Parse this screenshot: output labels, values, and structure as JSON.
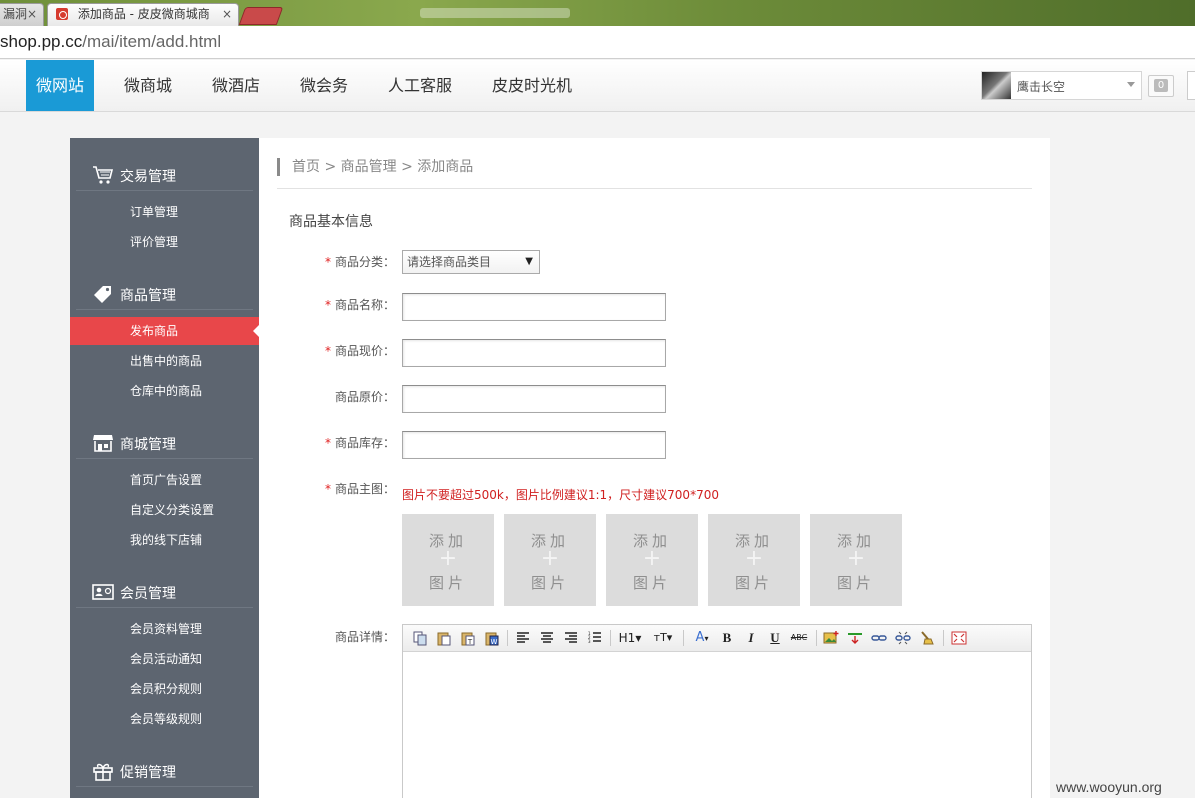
{
  "browser": {
    "tabs": [
      {
        "label": "漏洞",
        "close": "×"
      },
      {
        "label": "添加商品 - 皮皮微商城商",
        "close": "×"
      }
    ],
    "url_host": "shop.pp.cc",
    "url_path": "/mai/item/add.html"
  },
  "topnav": {
    "items": [
      "微网站",
      "微商城",
      "微酒店",
      "微会务",
      "人工客服",
      "皮皮时光机"
    ],
    "active": "微网站",
    "username": "鹰击长空",
    "msg_count": "0"
  },
  "sidebar": {
    "sections": [
      {
        "title": "交易管理",
        "icon": "cart-icon",
        "items": [
          "订单管理",
          "评价管理"
        ]
      },
      {
        "title": "商品管理",
        "icon": "tag-icon",
        "items": [
          "发布商品",
          "出售中的商品",
          "仓库中的商品"
        ]
      },
      {
        "title": "商城管理",
        "icon": "store-icon",
        "items": [
          "首页广告设置",
          "自定义分类设置",
          "我的线下店铺"
        ]
      },
      {
        "title": "会员管理",
        "icon": "member-card-icon",
        "items": [
          "会员资料管理",
          "会员活动通知",
          "会员积分规则",
          "会员等级规则"
        ]
      },
      {
        "title": "促销管理",
        "icon": "gift-icon",
        "items": []
      }
    ],
    "active_item": "发布商品"
  },
  "main": {
    "breadcrumb": "首页 > 商品管理 > 添加商品",
    "section_title": "商品基本信息",
    "form": {
      "category_label": "商品分类：",
      "category_placeholder": "请选择商品类目",
      "name_label": "商品名称：",
      "price_label": "商品现价：",
      "orig_price_label": "商品原价：",
      "stock_label": "商品库存：",
      "image_label": "商品主图：",
      "image_hint": "图片不要超过500k，图片比例建议1:1，尺寸建议700*700",
      "upload_line1": "添加",
      "upload_plus": "+",
      "upload_line2": "图片",
      "detail_label": "商品详情："
    },
    "required_mark": "*",
    "editor_buttons": {
      "h1": "H1",
      "fontsize": "тT",
      "fontcolor": "A",
      "bold": "B",
      "italic": "I",
      "underline": "U",
      "strike": "ABC"
    }
  },
  "watermark": "www.wooyun.org"
}
